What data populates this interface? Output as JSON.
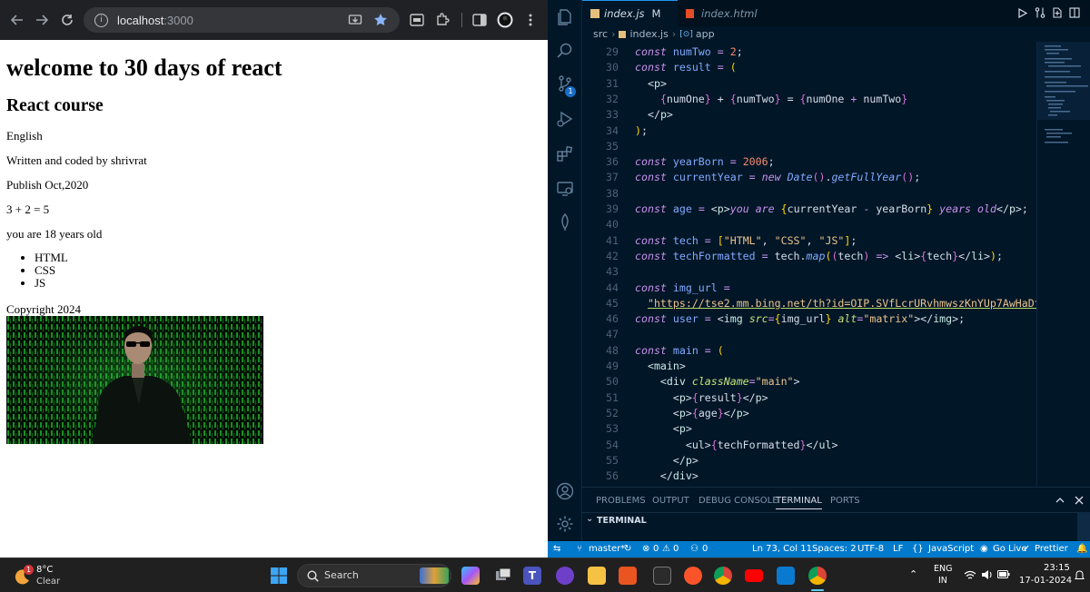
{
  "browser": {
    "url_host": "localhost",
    "url_port": ":3000"
  },
  "page": {
    "heading": "welcome to 30 days of react",
    "subheading": "React course",
    "language": "English",
    "author": "Written and coded by shrivrat",
    "published": "Publish Oct,2020",
    "sum": "3 + 2 = 5",
    "age": "you are 18 years old",
    "tech": [
      "HTML",
      "CSS",
      "JS"
    ],
    "copyright": "Copyright 2024",
    "image_alt": "matrix"
  },
  "vscode": {
    "tabs": [
      {
        "label": "index.js",
        "badge": "M"
      },
      {
        "label": "index.html"
      }
    ],
    "breadcrumb": [
      "src",
      "index.js",
      "app"
    ],
    "line_numbers": [
      "29",
      "30",
      "31",
      "32",
      "33",
      "34",
      "35",
      "36",
      "37",
      "38",
      "39",
      "40",
      "41",
      "42",
      "43",
      "44",
      "45",
      "46",
      "47",
      "48",
      "49",
      "50",
      "51",
      "52",
      "53",
      "54",
      "55",
      "56"
    ],
    "panel_tabs": [
      "PROBLEMS",
      "OUTPUT",
      "DEBUG CONSOLE",
      "TERMINAL",
      "PORTS"
    ],
    "terminal_label": "TERMINAL",
    "scm_badge": "1",
    "status": {
      "branch": "master*",
      "errors": "0",
      "warnings": "0",
      "ports": "0",
      "position": "Ln 73, Col 11",
      "spaces": "Spaces: 2",
      "encoding": "UTF-8",
      "eol": "LF",
      "language": "JavaScript",
      "golive": "Go Live",
      "prettier": "Prettier"
    }
  },
  "taskbar": {
    "weather_temp": "8°C",
    "weather_desc": "Clear",
    "weather_badge": "1",
    "search_label": "Search",
    "lang_top": "ENG",
    "lang_bottom": "IN",
    "time": "23:15",
    "date": "17-01-2024"
  }
}
